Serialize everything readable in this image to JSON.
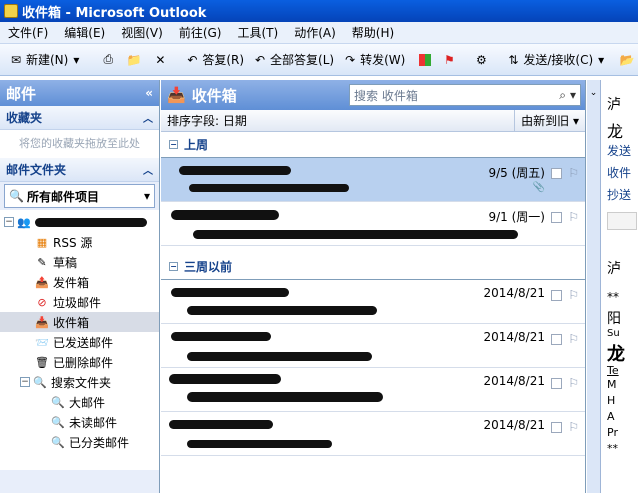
{
  "window": {
    "title": "收件箱 - Microsoft Outlook"
  },
  "menu": [
    "文件(F)",
    "编辑(E)",
    "视图(V)",
    "前往(G)",
    "工具(T)",
    "动作(A)",
    "帮助(H)"
  ],
  "toolbar": {
    "new": "新建(N)",
    "reply": "答复(R)",
    "reply_all": "全部答复(L)",
    "forward": "转发(W)",
    "send_receive": "发送/接收(C)"
  },
  "nav": {
    "header": "邮件",
    "favorites": "收藏夹",
    "favorites_hint": "将您的收藏夹拖放至此处",
    "mail_folders": "邮件文件夹",
    "all_mail": "所有邮件项目",
    "folders": [
      {
        "label": "RSS 源",
        "icon": "rss-icon"
      },
      {
        "label": "草稿",
        "icon": "draft-icon"
      },
      {
        "label": "发件箱",
        "icon": "outbox-icon"
      },
      {
        "label": "垃圾邮件",
        "icon": "junk-icon"
      },
      {
        "label": "收件箱",
        "icon": "inbox-icon",
        "selected": true
      },
      {
        "label": "已发送邮件",
        "icon": "sent-icon"
      },
      {
        "label": "已删除邮件",
        "icon": "deleted-icon"
      }
    ],
    "search_folders": {
      "label": "搜索文件夹",
      "children": [
        "大邮件",
        "未读邮件",
        "已分类邮件"
      ]
    }
  },
  "list": {
    "title": "收件箱",
    "search_placeholder": "搜索 收件箱",
    "sort_label": "排序字段: 日期",
    "sort_order": "由新到旧",
    "groups": [
      {
        "label": "上周",
        "messages": [
          {
            "date": "9/5 (周五)",
            "selected": true,
            "attachment": true
          },
          {
            "date": "9/1 (周一)",
            "selected": false,
            "attachment": false
          }
        ]
      },
      {
        "label": "三周以前",
        "messages": [
          {
            "date": "2014/8/21"
          },
          {
            "date": "2014/8/21"
          },
          {
            "date": "2014/8/21"
          },
          {
            "date": "2014/8/21"
          }
        ]
      }
    ]
  },
  "reading_pane": {
    "lines": [
      "泸",
      "龙",
      "发送",
      "收件",
      "抄送",
      "泸",
      "**",
      "阳",
      "Su",
      "龙",
      "Te",
      "M",
      "H",
      "A",
      "Pr",
      "**"
    ]
  }
}
